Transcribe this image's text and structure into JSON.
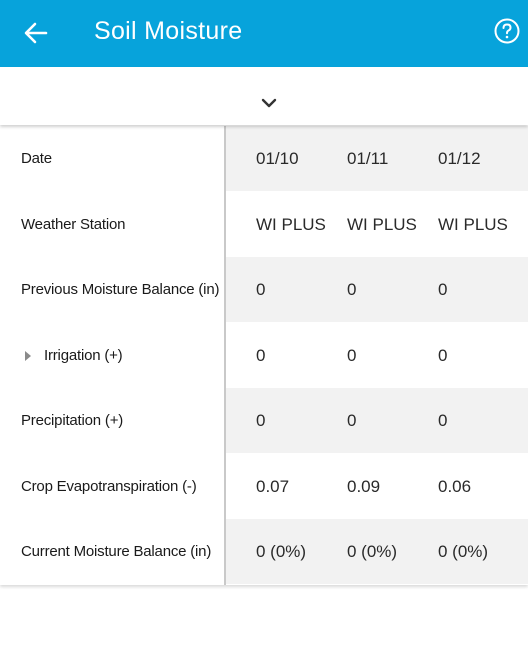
{
  "header": {
    "title": "Soil Moisture",
    "back_icon": "arrow-left-icon",
    "help_icon": "help-circle-icon",
    "color": "#07a3db"
  },
  "collapse": {
    "icon": "chevron-down-icon"
  },
  "table": {
    "rows": [
      {
        "label": "Date",
        "values": [
          "01/10",
          "01/11",
          "01/12"
        ],
        "shaded": true,
        "expandable": false
      },
      {
        "label": "Weather Station",
        "values": [
          "WI PLUS",
          "WI PLUS",
          "WI PLUS"
        ],
        "shaded": false,
        "expandable": false
      },
      {
        "label": "Previous Moisture Balance (in)",
        "values": [
          "0",
          "0",
          "0"
        ],
        "shaded": true,
        "expandable": false
      },
      {
        "label": "Irrigation (+)",
        "values": [
          "0",
          "0",
          "0"
        ],
        "shaded": false,
        "expandable": true
      },
      {
        "label": "Precipitation (+)",
        "values": [
          "0",
          "0",
          "0"
        ],
        "shaded": true,
        "expandable": false
      },
      {
        "label": "Crop Evapotranspiration (-)",
        "values": [
          "0.07",
          "0.09",
          "0.06"
        ],
        "shaded": false,
        "expandable": false
      },
      {
        "label": "Current Moisture Balance (in)",
        "values": [
          "0 (0%)",
          "0 (0%)",
          "0 (0%)"
        ],
        "shaded": true,
        "expandable": false
      }
    ]
  }
}
